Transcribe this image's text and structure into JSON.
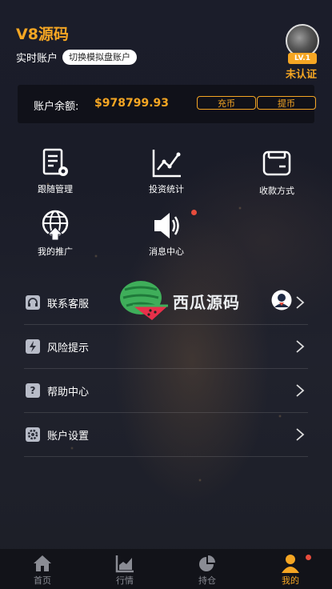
{
  "header": {
    "brand": "V8源码",
    "account_label": "实时账户",
    "switch_label": "切换模拟盘账户",
    "level": "LV.1",
    "verify_status": "未认证"
  },
  "balance": {
    "label": "账户余额:",
    "value": "$978799.93",
    "recharge_label": "充币",
    "withdraw_label": "提币"
  },
  "grid": {
    "follow": "跟随管理",
    "invest": "投资统计",
    "payment": "收款方式",
    "promote": "我的推广",
    "messages": "消息中心"
  },
  "menu": {
    "service": "联系客服",
    "risk": "风险提示",
    "help": "帮助中心",
    "settings": "账户设置"
  },
  "watermark": "西瓜源码",
  "tabs": {
    "home": "首页",
    "market": "行情",
    "positions": "持仓",
    "mine": "我的"
  },
  "colors": {
    "accent": "#f5a623",
    "badge_red": "#e74c3c"
  }
}
